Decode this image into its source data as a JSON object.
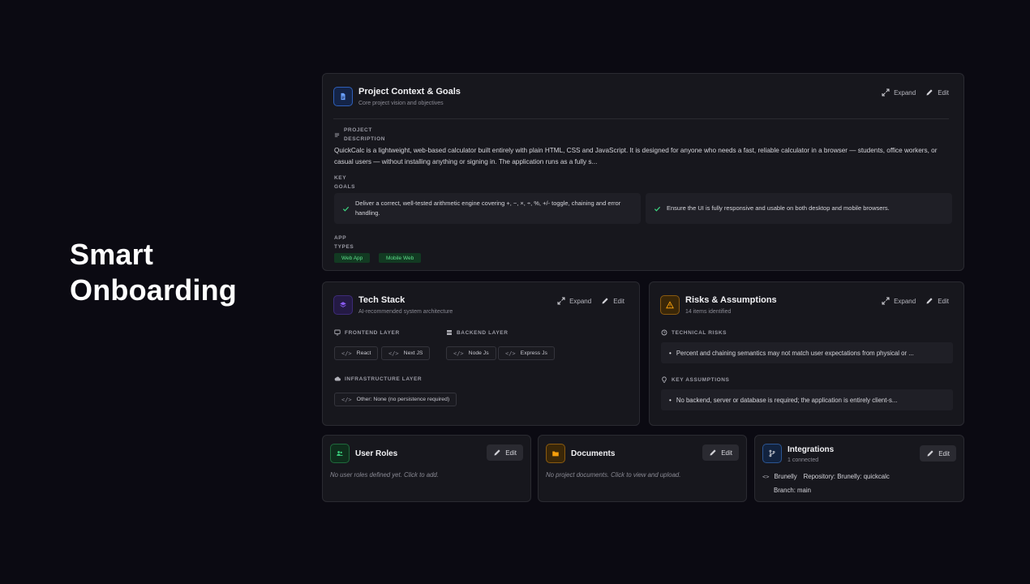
{
  "hero": {
    "line1": "Smart",
    "line2": "Onboarding"
  },
  "context": {
    "title": "Project Context & Goals",
    "subtitle": "Core project vision and objectives",
    "expand_label": "Expand",
    "edit_label": "Edit",
    "desc_label_1": "PROJECT",
    "desc_label_2": "DESCRIPTION",
    "description": "QuickCalc is a lightweight, web-based calculator built entirely with plain HTML, CSS and JavaScript. It is designed for anyone who needs a fast, reliable calculator in a browser — students, office workers, or casual users — without installing anything or signing in. The application runs as a fully s...",
    "goals_label_1": "KEY",
    "goals_label_2": "GOALS",
    "goals": [
      "Deliver a correct, well-tested arithmetic engine covering +, −, ×, ÷, %, +/- toggle, chaining and error handling.",
      "Ensure the UI is fully responsive and usable on both desktop and mobile browsers."
    ],
    "types_label_1": "APP",
    "types_label_2": "TYPES",
    "types": [
      "Web App",
      "Mobile Web"
    ]
  },
  "tech": {
    "title": "Tech Stack",
    "subtitle": "AI-recommended system architecture",
    "expand_label": "Expand",
    "edit_label": "Edit",
    "frontend_label": "FRONTEND LAYER",
    "frontend": [
      "React",
      "Next JS"
    ],
    "backend_label": "BACKEND LAYER",
    "backend": [
      "Node Js",
      "Express Js"
    ],
    "infra_label": "INFRASTRUCTURE LAYER",
    "infra": [
      "Other: None (no persistence required)"
    ]
  },
  "risks": {
    "title": "Risks & Assumptions",
    "subtitle": "14 items identified",
    "expand_label": "Expand",
    "edit_label": "Edit",
    "tech_label": "TECHNICAL RISKS",
    "tech_risk": "Percent and chaining semantics may not match user expectations from physical or ...",
    "assump_label": "KEY ASSUMPTIONS",
    "assumption": "No backend, server or database is required; the application is entirely client-s..."
  },
  "roles": {
    "title": "User Roles",
    "edit_label": "Edit",
    "empty": "No user roles defined yet. Click to add."
  },
  "docs": {
    "title": "Documents",
    "edit_label": "Edit",
    "empty": "No project documents. Click to view and upload."
  },
  "integrations": {
    "title": "Integrations",
    "subtitle": "1 connected",
    "edit_label": "Edit",
    "name": "Brunelly",
    "repo": "Repository: Brunelly: quickcalc",
    "branch": "Branch: main"
  },
  "colors": {
    "background": "#0b0a12",
    "card": "#17171d",
    "accent_blue": "#3b82f6",
    "accent_purple": "#8b5cf6",
    "accent_orange": "#f59e0b",
    "accent_green": "#22c55e"
  }
}
